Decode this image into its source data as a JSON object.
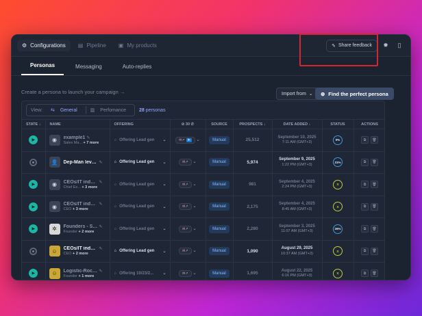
{
  "topbar": {
    "tabs": [
      {
        "label": "Configurations",
        "icon": "settings-icon"
      },
      {
        "label": "Pipeline",
        "icon": "pipeline-icon"
      },
      {
        "label": "My products",
        "icon": "box-icon"
      }
    ],
    "feedback_label": "Share feedback"
  },
  "subtabs": [
    "Personas",
    "Messaging",
    "Auto-replies"
  ],
  "actionbar": {
    "hint": "Create a persona to launch your campaign",
    "import_label": "Import from",
    "find_label": "Find the perfect persona"
  },
  "viewbar": {
    "view_label": "View:",
    "general_label": "General",
    "performance_label": "Perfomance",
    "count_number": "28",
    "count_suffix": "personas"
  },
  "columns": [
    "STATE",
    "NAME",
    "OFFERING",
    "",
    "SOURCE",
    "PROSPECTS",
    "DATE ADDED",
    "STATUS",
    "ACTIONS"
  ],
  "rows": [
    {
      "state": "play",
      "avatar": "sm",
      "name": "example1",
      "sub1": "Sales Ma...",
      "sub2": "+ 7 more",
      "offering": "Offering Lead gen",
      "source": "Manual",
      "prospects": "25,512",
      "date": "September 10, 2025",
      "time": "7:11 AM (GMT+3)",
      "status": "0%",
      "dim": true
    },
    {
      "state": "stop",
      "avatar": "user",
      "name": "Dep-Man level...",
      "sub1": "",
      "sub2": "",
      "offering": "Offering Lead gen",
      "source": "Manual",
      "prospects": "5,974",
      "date": "September 9, 2025",
      "time": "1:22 PM (GMT+3)",
      "status": "31%",
      "dim": false
    },
    {
      "state": "play",
      "avatar": "sm",
      "name": "CEOs/IT indus...",
      "sub1": "Chief Ex...",
      "sub2": "+ 3 more",
      "offering": "Offering Lead gen",
      "source": "Manual",
      "prospects": "981",
      "date": "September 4, 2025",
      "time": "2:24 PM (GMT+3)",
      "status": "S",
      "dim": true
    },
    {
      "state": "play",
      "avatar": "sm",
      "name": "CEOs/IT indus...",
      "sub1": "CEO",
      "sub2": "+ 3 more",
      "offering": "Offering Lead gen",
      "source": "Manual",
      "prospects": "2,175",
      "date": "September 4, 2025",
      "time": "8:45 AM (GMT+3)",
      "status": "S",
      "dim": true
    },
    {
      "state": "play",
      "avatar": "w",
      "name": "Founders - Sta...",
      "sub1": "Founder",
      "sub2": "+ 2 more",
      "offering": "Offering Lead gen",
      "source": "Manual",
      "prospects": "2,280",
      "date": "September 3, 2025",
      "time": "11:07 AM (GMT+3)",
      "status": "26%",
      "dim": true
    },
    {
      "state": "stop",
      "avatar": "y",
      "name": "CEOs/IT indus...",
      "sub1": "CEO",
      "sub2": "+ 2 more",
      "offering": "Offering Lead gen",
      "source": "Manual",
      "prospects": "1,090",
      "date": "August 29, 2025",
      "time": "10:37 AM (GMT+3)",
      "status": "S",
      "dim": false
    },
    {
      "state": "play",
      "avatar": "y",
      "name": "Logistic-Rock...",
      "sub1": "Founder",
      "sub2": "+ 1 more",
      "offering": "Offering 10/23/2...",
      "source": "Manual",
      "prospects": "1,695",
      "date": "August 22, 2025",
      "time": "6:16 PM (GMT+3)",
      "status": "S",
      "dim": true
    }
  ]
}
